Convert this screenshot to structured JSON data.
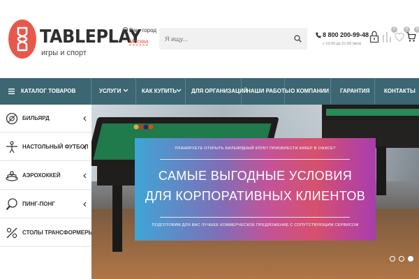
{
  "brand": {
    "name": "TABLEPLAY",
    "tagline": "игры и спорт",
    "color": "#e8584a"
  },
  "city": {
    "label": "Ваш город",
    "value": "Москва"
  },
  "search": {
    "placeholder": "Я ищу..."
  },
  "contacts": {
    "phone": "8 800 200-99-48",
    "hours": "с 10:00 до 21:00 (мск)"
  },
  "header_icons": [
    {
      "icon": "lock-icon",
      "badge": ""
    },
    {
      "icon": "compare-icon",
      "badge": "0"
    },
    {
      "icon": "heart-icon",
      "badge": "0"
    },
    {
      "icon": "cart-icon",
      "badge": "0"
    }
  ],
  "nav": {
    "catalog": "Каталог товаров",
    "items": [
      "Услуги",
      "Как купить",
      "Для организаций",
      "Наши работы",
      "О компании",
      "Гарантия",
      "Контакты"
    ],
    "color": "#3b6672"
  },
  "sidebar": {
    "items": [
      {
        "label": "Бильярд",
        "icon": "billiard-icon",
        "has_submenu": true
      },
      {
        "label": "Настольный футбол",
        "icon": "foosball-icon",
        "has_submenu": true
      },
      {
        "label": "Аэрохоккей",
        "icon": "air-hockey-icon",
        "has_submenu": true
      },
      {
        "label": "Пинг-понг",
        "icon": "ping-pong-icon",
        "has_submenu": true
      },
      {
        "label": "Столы трансформеры",
        "icon": "transformer-table-icon",
        "has_submenu": false
      }
    ]
  },
  "hero": {
    "top_text": "Планируете открыть бильярдный клуб? Приобрести кикер в офисе?",
    "headline_1": "Самые выгодные условия",
    "headline_2": "для корпоративных клиентов",
    "bottom_text": "Подготовим для вас лучшее коммерческое предложение с сопутствующим сервисом",
    "slides": 3,
    "active_slide": 3
  }
}
